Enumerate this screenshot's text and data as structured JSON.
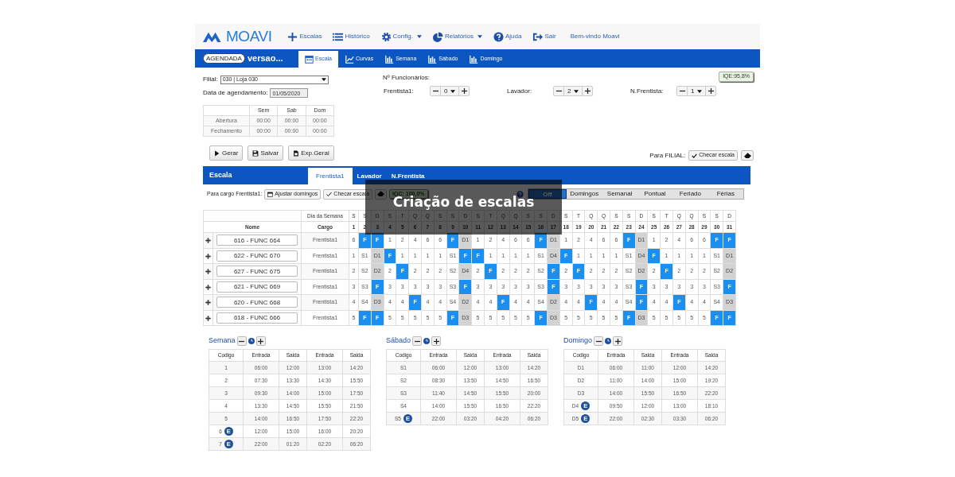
{
  "nav": {
    "logo": "MOAVI",
    "items": [
      {
        "label": "Escalas",
        "dropdown": false
      },
      {
        "label": "Histórico",
        "dropdown": false
      },
      {
        "label": "Config.",
        "dropdown": true
      },
      {
        "label": "Relatórios",
        "dropdown": true
      },
      {
        "label": "Ajuda",
        "dropdown": false
      },
      {
        "label": "Sair",
        "dropdown": false
      }
    ],
    "welcome": "Bem-vindo Moavi"
  },
  "header": {
    "badge": "AGENDADA",
    "title": "versao...",
    "tabs": [
      {
        "label": "Escala",
        "selected": true
      },
      {
        "label": "Curvas",
        "selected": false
      },
      {
        "label": "Semana",
        "selected": false
      },
      {
        "label": "Sábado",
        "selected": false
      },
      {
        "label": "Domingo",
        "selected": false
      }
    ]
  },
  "filters": {
    "filial_label": "Filial:",
    "filial_value": "030 | Loja 030",
    "date_label": "Data de agendamento:",
    "date_value": "01/05/2020",
    "hours": {
      "columns": [
        "Sem",
        "Sab",
        "Dom"
      ],
      "rows": [
        {
          "label": "Abertura",
          "values": [
            "00:00",
            "00:00",
            "00:00"
          ]
        },
        {
          "label": "Fechamento",
          "values": [
            "00:00",
            "00:00",
            "00:00"
          ]
        }
      ]
    }
  },
  "staff": {
    "title": "Nº Funcionários:",
    "iqe": "IQE:95,8%",
    "roles": [
      {
        "label": "Frentista1:",
        "value": "0"
      },
      {
        "label": "Lavador:",
        "value": "2"
      },
      {
        "label": "N.Frentista:",
        "value": "1"
      }
    ]
  },
  "actions": [
    "Gerar",
    "Salvar",
    "Exp.Geral"
  ],
  "filial_check": {
    "label": "Para FILIAL:",
    "button": "Checar escala"
  },
  "escala": {
    "title": "Escala",
    "tabs": [
      {
        "label": "Frentista1",
        "selected": true
      },
      {
        "label": "Lavador",
        "selected": false
      },
      {
        "label": "N.Frentista",
        "selected": false
      }
    ],
    "cargo_label": "Para cargo Frentista1:",
    "buttons": [
      "Ajustar domingos",
      "Checar escala"
    ],
    "iqc": "IQC: 100,0%",
    "legend": [
      {
        "label": "Off",
        "selected": true
      },
      {
        "label": "Domingos",
        "selected": false
      },
      {
        "label": "Semanal",
        "selected": false
      },
      {
        "label": "Pontual",
        "selected": false
      },
      {
        "label": "Feriado",
        "selected": false
      },
      {
        "label": "Férias",
        "selected": false
      }
    ]
  },
  "grid": {
    "weekday_label": "Dia da Semana",
    "name_label": "Nome",
    "cargo_label": "Cargo",
    "weekdays": [
      "S",
      "S",
      "D",
      "S",
      "T",
      "Q",
      "Q",
      "S",
      "S",
      "D",
      "S",
      "T",
      "Q",
      "Q",
      "S",
      "S",
      "D",
      "S",
      "T",
      "Q",
      "Q",
      "S",
      "S",
      "D",
      "S",
      "T",
      "Q",
      "Q",
      "S",
      "S",
      "D"
    ],
    "days": [
      "1",
      "2",
      "3",
      "4",
      "5",
      "6",
      "7",
      "8",
      "9",
      "10",
      "11",
      "12",
      "13",
      "14",
      "15",
      "16",
      "17",
      "18",
      "19",
      "20",
      "21",
      "22",
      "23",
      "24",
      "25",
      "26",
      "27",
      "28",
      "29",
      "30",
      "31"
    ],
    "rows": [
      {
        "name": "616 - FUNC 664",
        "cargo": "Frentista1",
        "cells": [
          {
            "text": "6",
            "kind": "turno"
          },
          {
            "text": "F",
            "kind": "folga"
          },
          {
            "text": "F",
            "kind": "folga"
          },
          {
            "text": "1",
            "kind": "turno"
          },
          {
            "text": "2",
            "kind": "turno"
          },
          {
            "text": "4",
            "kind": "turno"
          },
          {
            "text": "6",
            "kind": "turno"
          },
          {
            "text": "6",
            "kind": "turno"
          },
          {
            "text": "F",
            "kind": "folga"
          },
          {
            "text": "D1",
            "kind": "domingo"
          },
          {
            "text": "1",
            "kind": "turno"
          },
          {
            "text": "2",
            "kind": "turno"
          },
          {
            "text": "4",
            "kind": "turno"
          },
          {
            "text": "6",
            "kind": "turno"
          },
          {
            "text": "6",
            "kind": "turno"
          },
          {
            "text": "F",
            "kind": "folga"
          },
          {
            "text": "D1",
            "kind": "domingo"
          },
          {
            "text": "1",
            "kind": "turno"
          },
          {
            "text": "2",
            "kind": "turno"
          },
          {
            "text": "4",
            "kind": "turno"
          },
          {
            "text": "6",
            "kind": "turno"
          },
          {
            "text": "6",
            "kind": "turno"
          },
          {
            "text": "F",
            "kind": "folga"
          },
          {
            "text": "D1",
            "kind": "domingo"
          },
          {
            "text": "1",
            "kind": "turno"
          },
          {
            "text": "2",
            "kind": "turno"
          },
          {
            "text": "4",
            "kind": "turno"
          },
          {
            "text": "6",
            "kind": "turno"
          },
          {
            "text": "6",
            "kind": "turno"
          },
          {
            "text": "F",
            "kind": "folga"
          },
          {
            "text": "F",
            "kind": "folga"
          }
        ]
      },
      {
        "name": "622 - FUNC 670",
        "cargo": "Frentista1",
        "cells": [
          {
            "text": "1",
            "kind": "turno"
          },
          {
            "text": "S1",
            "kind": "turno"
          },
          {
            "text": "D1",
            "kind": "domingo"
          },
          {
            "text": "F",
            "kind": "folga"
          },
          {
            "text": "1",
            "kind": "turno"
          },
          {
            "text": "1",
            "kind": "turno"
          },
          {
            "text": "1",
            "kind": "turno"
          },
          {
            "text": "1",
            "kind": "turno"
          },
          {
            "text": "S1",
            "kind": "turno"
          },
          {
            "text": "F",
            "kind": "folga"
          },
          {
            "text": "F",
            "kind": "folga"
          },
          {
            "text": "1",
            "kind": "turno"
          },
          {
            "text": "1",
            "kind": "turno"
          },
          {
            "text": "1",
            "kind": "turno"
          },
          {
            "text": "1",
            "kind": "turno"
          },
          {
            "text": "S1",
            "kind": "turno"
          },
          {
            "text": "D4",
            "kind": "domingo"
          },
          {
            "text": "F",
            "kind": "folga"
          },
          {
            "text": "1",
            "kind": "turno"
          },
          {
            "text": "1",
            "kind": "turno"
          },
          {
            "text": "1",
            "kind": "turno"
          },
          {
            "text": "1",
            "kind": "turno"
          },
          {
            "text": "S1",
            "kind": "turno"
          },
          {
            "text": "D4",
            "kind": "domingo"
          },
          {
            "text": "F",
            "kind": "folga"
          },
          {
            "text": "1",
            "kind": "turno"
          },
          {
            "text": "1",
            "kind": "turno"
          },
          {
            "text": "1",
            "kind": "turno"
          },
          {
            "text": "1",
            "kind": "turno"
          },
          {
            "text": "S1",
            "kind": "turno"
          },
          {
            "text": "D1",
            "kind": "domingo"
          }
        ]
      },
      {
        "name": "627 - FUNC 675",
        "cargo": "Frentista1",
        "cells": [
          {
            "text": "2",
            "kind": "turno"
          },
          {
            "text": "S2",
            "kind": "turno"
          },
          {
            "text": "D2",
            "kind": "domingo"
          },
          {
            "text": "2",
            "kind": "turno"
          },
          {
            "text": "F",
            "kind": "folga"
          },
          {
            "text": "2",
            "kind": "turno"
          },
          {
            "text": "2",
            "kind": "turno"
          },
          {
            "text": "2",
            "kind": "turno"
          },
          {
            "text": "S2",
            "kind": "turno"
          },
          {
            "text": "D4",
            "kind": "domingo"
          },
          {
            "text": "2",
            "kind": "turno"
          },
          {
            "text": "F",
            "kind": "folga"
          },
          {
            "text": "2",
            "kind": "turno"
          },
          {
            "text": "2",
            "kind": "turno"
          },
          {
            "text": "2",
            "kind": "turno"
          },
          {
            "text": "S2",
            "kind": "turno"
          },
          {
            "text": "F",
            "kind": "folga"
          },
          {
            "text": "2",
            "kind": "turno"
          },
          {
            "text": "F",
            "kind": "folga"
          },
          {
            "text": "2",
            "kind": "turno"
          },
          {
            "text": "2",
            "kind": "turno"
          },
          {
            "text": "2",
            "kind": "turno"
          },
          {
            "text": "S2",
            "kind": "turno"
          },
          {
            "text": "D2",
            "kind": "domingo"
          },
          {
            "text": "2",
            "kind": "turno"
          },
          {
            "text": "F",
            "kind": "folga"
          },
          {
            "text": "2",
            "kind": "turno"
          },
          {
            "text": "2",
            "kind": "turno"
          },
          {
            "text": "2",
            "kind": "turno"
          },
          {
            "text": "S2",
            "kind": "turno"
          },
          {
            "text": "D2",
            "kind": "domingo"
          }
        ]
      },
      {
        "name": "621 - FUNC 669",
        "cargo": "Frentista1",
        "cells": [
          {
            "text": "3",
            "kind": "turno"
          },
          {
            "text": "S3",
            "kind": "turno"
          },
          {
            "text": "F",
            "kind": "folga"
          },
          {
            "text": "3",
            "kind": "turno"
          },
          {
            "text": "3",
            "kind": "turno"
          },
          {
            "text": "3",
            "kind": "turno"
          },
          {
            "text": "3",
            "kind": "turno"
          },
          {
            "text": "3",
            "kind": "turno"
          },
          {
            "text": "S3",
            "kind": "turno"
          },
          {
            "text": "F",
            "kind": "folga"
          },
          {
            "text": "3",
            "kind": "turno"
          },
          {
            "text": "3",
            "kind": "turno"
          },
          {
            "text": "3",
            "kind": "turno"
          },
          {
            "text": "3",
            "kind": "turno"
          },
          {
            "text": "3",
            "kind": "turno"
          },
          {
            "text": "S3",
            "kind": "turno"
          },
          {
            "text": "F",
            "kind": "folga"
          },
          {
            "text": "3",
            "kind": "turno"
          },
          {
            "text": "3",
            "kind": "turno"
          },
          {
            "text": "3",
            "kind": "turno"
          },
          {
            "text": "3",
            "kind": "turno"
          },
          {
            "text": "3",
            "kind": "turno"
          },
          {
            "text": "S3",
            "kind": "turno"
          },
          {
            "text": "F",
            "kind": "folga"
          },
          {
            "text": "3",
            "kind": "turno"
          },
          {
            "text": "3",
            "kind": "turno"
          },
          {
            "text": "3",
            "kind": "turno"
          },
          {
            "text": "3",
            "kind": "turno"
          },
          {
            "text": "3",
            "kind": "turno"
          },
          {
            "text": "S3",
            "kind": "turno"
          },
          {
            "text": "F",
            "kind": "folga"
          }
        ]
      },
      {
        "name": "620 - FUNC 668",
        "cargo": "Frentista1",
        "cells": [
          {
            "text": "4",
            "kind": "turno"
          },
          {
            "text": "S4",
            "kind": "turno"
          },
          {
            "text": "D3",
            "kind": "domingo"
          },
          {
            "text": "4",
            "kind": "turno"
          },
          {
            "text": "4",
            "kind": "turno"
          },
          {
            "text": "F",
            "kind": "folga"
          },
          {
            "text": "4",
            "kind": "turno"
          },
          {
            "text": "4",
            "kind": "turno"
          },
          {
            "text": "S4",
            "kind": "turno"
          },
          {
            "text": "D2",
            "kind": "domingo"
          },
          {
            "text": "4",
            "kind": "turno"
          },
          {
            "text": "4",
            "kind": "turno"
          },
          {
            "text": "F",
            "kind": "folga"
          },
          {
            "text": "4",
            "kind": "turno"
          },
          {
            "text": "4",
            "kind": "turno"
          },
          {
            "text": "S4",
            "kind": "turno"
          },
          {
            "text": "D2",
            "kind": "domingo"
          },
          {
            "text": "4",
            "kind": "turno"
          },
          {
            "text": "4",
            "kind": "turno"
          },
          {
            "text": "F",
            "kind": "folga"
          },
          {
            "text": "4",
            "kind": "turno"
          },
          {
            "text": "4",
            "kind": "turno"
          },
          {
            "text": "S4",
            "kind": "turno"
          },
          {
            "text": "F",
            "kind": "folga"
          },
          {
            "text": "4",
            "kind": "turno"
          },
          {
            "text": "4",
            "kind": "turno"
          },
          {
            "text": "F",
            "kind": "folga"
          },
          {
            "text": "4",
            "kind": "turno"
          },
          {
            "text": "4",
            "kind": "turno"
          },
          {
            "text": "S4",
            "kind": "turno"
          },
          {
            "text": "D3",
            "kind": "domingo"
          }
        ]
      },
      {
        "name": "618 - FUNC 666",
        "cargo": "Frentista1",
        "cells": [
          {
            "text": "5",
            "kind": "turno"
          },
          {
            "text": "F",
            "kind": "folga"
          },
          {
            "text": "F",
            "kind": "folga"
          },
          {
            "text": "5",
            "kind": "turno"
          },
          {
            "text": "5",
            "kind": "turno"
          },
          {
            "text": "5",
            "kind": "turno"
          },
          {
            "text": "5",
            "kind": "turno"
          },
          {
            "text": "5",
            "kind": "turno"
          },
          {
            "text": "F",
            "kind": "folga"
          },
          {
            "text": "D3",
            "kind": "domingo"
          },
          {
            "text": "5",
            "kind": "turno"
          },
          {
            "text": "5",
            "kind": "turno"
          },
          {
            "text": "5",
            "kind": "turno"
          },
          {
            "text": "5",
            "kind": "turno"
          },
          {
            "text": "5",
            "kind": "turno"
          },
          {
            "text": "F",
            "kind": "folga"
          },
          {
            "text": "D3",
            "kind": "domingo"
          },
          {
            "text": "5",
            "kind": "turno"
          },
          {
            "text": "5",
            "kind": "turno"
          },
          {
            "text": "5",
            "kind": "turno"
          },
          {
            "text": "5",
            "kind": "turno"
          },
          {
            "text": "5",
            "kind": "turno"
          },
          {
            "text": "F",
            "kind": "folga"
          },
          {
            "text": "D3",
            "kind": "domingo"
          },
          {
            "text": "5",
            "kind": "turno"
          },
          {
            "text": "5",
            "kind": "turno"
          },
          {
            "text": "5",
            "kind": "turno"
          },
          {
            "text": "5",
            "kind": "turno"
          },
          {
            "text": "5",
            "kind": "turno"
          },
          {
            "text": "F",
            "kind": "folga"
          },
          {
            "text": "F",
            "kind": "folga"
          }
        ]
      }
    ]
  },
  "shifts": [
    {
      "title": "Semana",
      "columns": [
        "Codigo",
        "Entrada",
        "Saida",
        "Entrada",
        "Saida"
      ],
      "rows": [
        {
          "code": "1",
          "times": [
            "06:00",
            "12:00",
            "13:00",
            "14:20"
          ]
        },
        {
          "code": "2",
          "times": [
            "07:30",
            "13:30",
            "14:30",
            "15:50"
          ]
        },
        {
          "code": "3",
          "times": [
            "09:30",
            "14:00",
            "15:00",
            "17:50"
          ]
        },
        {
          "code": "4",
          "times": [
            "13:30",
            "14:50",
            "15:50",
            "21:50"
          ]
        },
        {
          "code": "5",
          "times": [
            "14:00",
            "16:50",
            "17:50",
            "22:20"
          ]
        },
        {
          "code": "6",
          "badge": "E",
          "times": [
            "12:00",
            "15:00",
            "16:00",
            "20:20"
          ]
        },
        {
          "code": "7",
          "badge": "E",
          "times": [
            "22:00",
            "01:20",
            "02:20",
            "06:20"
          ]
        }
      ]
    },
    {
      "title": "Sábado",
      "columns": [
        "Codigo",
        "Entrada",
        "Saida",
        "Entrada",
        "Saida"
      ],
      "rows": [
        {
          "code": "S1",
          "times": [
            "06:00",
            "12:00",
            "13:00",
            "14:20"
          ]
        },
        {
          "code": "S2",
          "times": [
            "08:30",
            "13:50",
            "14:50",
            "16:50"
          ]
        },
        {
          "code": "S3",
          "times": [
            "11:40",
            "14:50",
            "15:50",
            "20:00"
          ]
        },
        {
          "code": "S4",
          "times": [
            "14:00",
            "15:50",
            "16:50",
            "22:20"
          ]
        },
        {
          "code": "S5",
          "badge": "E",
          "times": [
            "22:00",
            "03:20",
            "04:20",
            "06:20"
          ]
        }
      ]
    },
    {
      "title": "Domingo",
      "columns": [
        "Codigo",
        "Entrada",
        "Saida",
        "Entrada",
        "Saida"
      ],
      "rows": [
        {
          "code": "D1",
          "times": [
            "06:00",
            "11:00",
            "12:00",
            "14:20"
          ]
        },
        {
          "code": "D2",
          "times": [
            "11:00",
            "14:00",
            "15:00",
            "19:20"
          ]
        },
        {
          "code": "D3",
          "times": [
            "14:00",
            "15:50",
            "16:50",
            "22:20"
          ]
        },
        {
          "code": "D4",
          "badge": "E",
          "times": [
            "09:50",
            "12:00",
            "13:00",
            "18:10"
          ]
        },
        {
          "code": "D5",
          "badge": "E",
          "times": [
            "22:00",
            "02:30",
            "03:30",
            "06:20"
          ]
        }
      ]
    }
  ],
  "overlay": {
    "title": "Criação de escalas"
  }
}
